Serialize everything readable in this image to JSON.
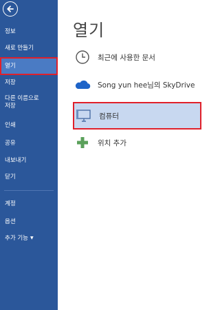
{
  "sidebar": {
    "back_icon": "back-arrow-icon",
    "items": [
      {
        "label": "정보"
      },
      {
        "label": "새로 만들기"
      },
      {
        "label": "열기"
      },
      {
        "label": "저장"
      },
      {
        "label": "다른 이름으로\n저장"
      },
      {
        "label": "인쇄"
      },
      {
        "label": "공유"
      },
      {
        "label": "내보내기"
      },
      {
        "label": "닫기"
      },
      {
        "label": "계정"
      },
      {
        "label": "옵션"
      },
      {
        "label": "추가 기능"
      }
    ],
    "selected_index": 2,
    "background": "#2b579a",
    "selected_background": "#4a7bc4",
    "highlight_color": "#e0202a"
  },
  "main": {
    "title": "열기",
    "places": [
      {
        "label": "최근에 사용한 문서",
        "icon": "clock-icon"
      },
      {
        "label": "Song yun hee님의 SkyDrive",
        "icon": "cloud-icon"
      },
      {
        "label": "컴퓨터",
        "icon": "computer-icon"
      },
      {
        "label": "위치 추가",
        "icon": "plus-icon"
      }
    ],
    "selected_index": 2,
    "selected_background": "#c8d8f0"
  }
}
